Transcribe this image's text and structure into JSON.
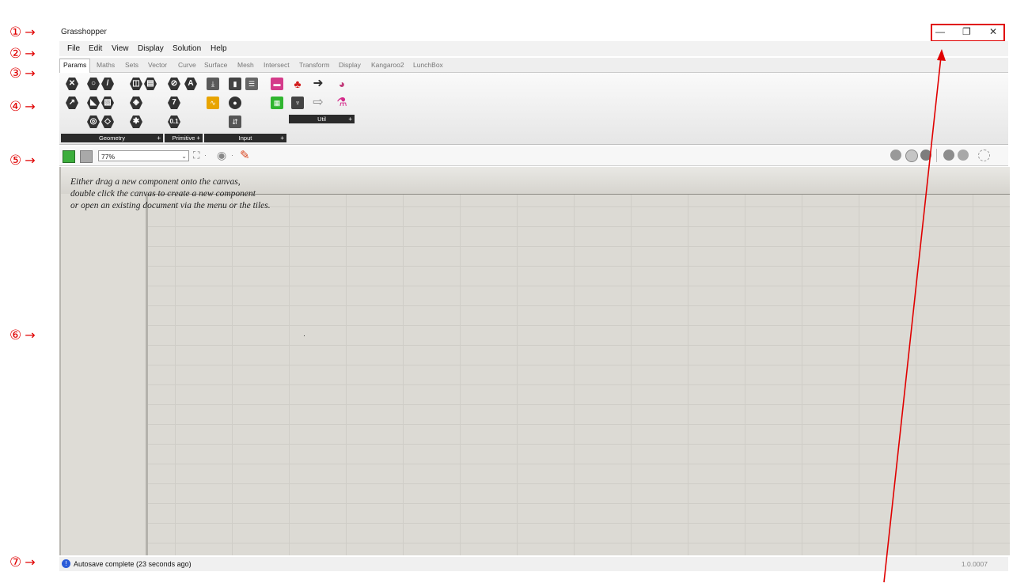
{
  "app": {
    "title": "Grasshopper"
  },
  "markers": [
    "①",
    "②",
    "③",
    "④",
    "⑤",
    "⑥",
    "⑦"
  ],
  "window_controls": {
    "minimize": "—",
    "restore": "❐",
    "close": "✕"
  },
  "menubar": [
    "File",
    "Edit",
    "View",
    "Display",
    "Solution",
    "Help"
  ],
  "tabs": [
    "Params",
    "Maths",
    "Sets",
    "Vector",
    "Curve",
    "Surface",
    "Mesh",
    "Intersect",
    "Transform",
    "Display",
    "Kangaroo2",
    "LunchBox"
  ],
  "active_tab": "Params",
  "ribbon": {
    "panels": [
      {
        "label": "Geometry",
        "plus": "+"
      },
      {
        "label": "Primitive",
        "plus": "+"
      },
      {
        "label": "Input",
        "plus": "+"
      },
      {
        "label": "Util",
        "plus": "+"
      }
    ],
    "primitive_icons": [
      "A",
      "7",
      "0.1"
    ]
  },
  "toolbar": {
    "zoom": "77%"
  },
  "canvas": {
    "hint_lines": [
      "Either drag a new component onto the canvas,",
      "double click the canvas to create a new component",
      "or open an existing document via the menu or the tiles."
    ]
  },
  "statusbar": {
    "message": "Autosave complete (23 seconds ago)",
    "version": "1.0.0007"
  },
  "colors": {
    "annotation": "#e00000",
    "canvas": "#dcdad4",
    "status_icon": "#2a5bd8"
  }
}
